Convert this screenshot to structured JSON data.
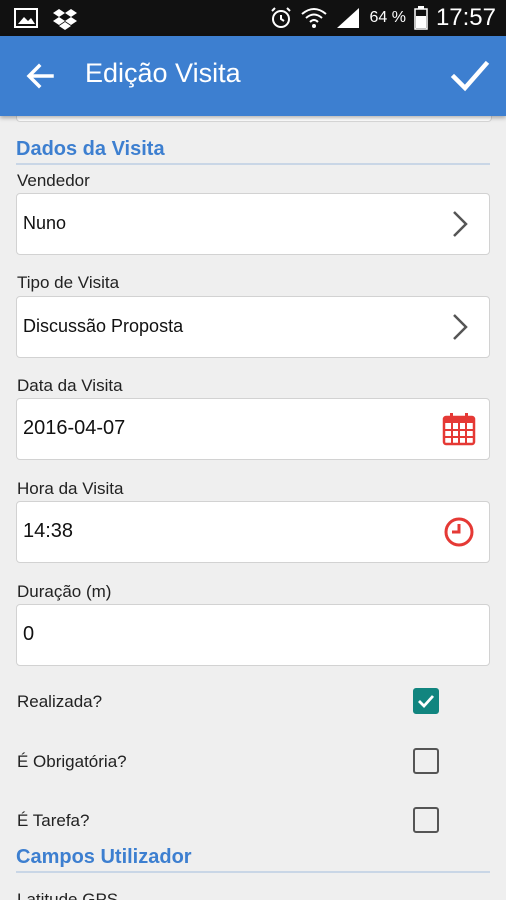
{
  "status_bar": {
    "battery": "64 %",
    "time": "17:57"
  },
  "header": {
    "title": "Edição Visita"
  },
  "sections": {
    "dados": "Dados da Visita",
    "campos": "Campos Utilizador"
  },
  "fields": {
    "vendedor": {
      "label": "Vendedor",
      "value": "Nuno"
    },
    "tipo": {
      "label": "Tipo de Visita",
      "value": "Discussão Proposta"
    },
    "data": {
      "label": "Data da Visita",
      "value": "2016-04-07"
    },
    "hora": {
      "label": "Hora da Visita",
      "value": "14:38"
    },
    "duracao": {
      "label": "Duração (m)",
      "value": "0"
    }
  },
  "checks": [
    {
      "label": "Realizada?",
      "checked": true
    },
    {
      "label": "É Obrigatória?",
      "checked": false
    },
    {
      "label": "É Tarefa?",
      "checked": false
    }
  ],
  "partial_label": "Latitude GPS",
  "colors": {
    "appbar": "#3d7fd0",
    "accent_red": "#e53935",
    "check_teal": "#11857f"
  }
}
